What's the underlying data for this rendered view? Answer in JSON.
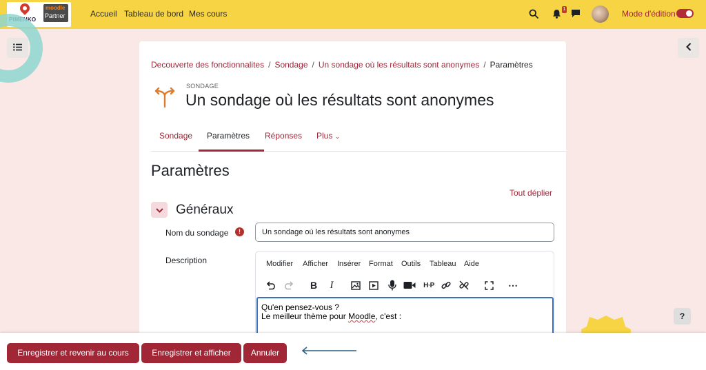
{
  "navbar": {
    "logo_text": "PIMENKO",
    "partner_brand": "moodle",
    "partner_label": "Partner",
    "links": [
      "Accueil",
      "Tableau de bord",
      "Mes cours"
    ],
    "notification_count": "1",
    "edit_mode_label": "Mode d'édition",
    "edit_mode_on": true
  },
  "breadcrumb": {
    "items": [
      "Decouverte des fonctionnalites",
      "Sondage",
      "Un sondage où les résultats sont anonymes"
    ],
    "current": "Paramètres"
  },
  "activity": {
    "type_label": "SONDAGE",
    "title": "Un sondage où les résultats sont anonymes"
  },
  "tabs": [
    "Sondage",
    "Paramètres",
    "Réponses",
    "Plus"
  ],
  "active_tab": "Paramètres",
  "page": {
    "heading": "Paramètres",
    "expand_all": "Tout déplier"
  },
  "section": {
    "title": "Généraux",
    "name_label": "Nom du sondage",
    "name_value": "Un sondage où les résultats sont anonymes",
    "description_label": "Description"
  },
  "editor": {
    "menu": [
      "Modifier",
      "Afficher",
      "Insérer",
      "Format",
      "Outils",
      "Tableau",
      "Aide"
    ],
    "content_line1": "Qu'en pensez-vous ?",
    "content_line2_before": "Le meilleur thème pour ",
    "content_line2_word": "Moodle",
    "content_line2_after": ", c'est :"
  },
  "footer": {
    "save_return": "Enregistrer et revenir au cours",
    "save_display": "Enregistrer et afficher",
    "cancel": "Annuler"
  },
  "help_label": "?",
  "colors": {
    "navbar": "#f6d443",
    "primary": "#a12636",
    "background": "#f9e8e6",
    "decor_teal": "#8fd6cf",
    "editor_focus": "#3b6fbf"
  }
}
